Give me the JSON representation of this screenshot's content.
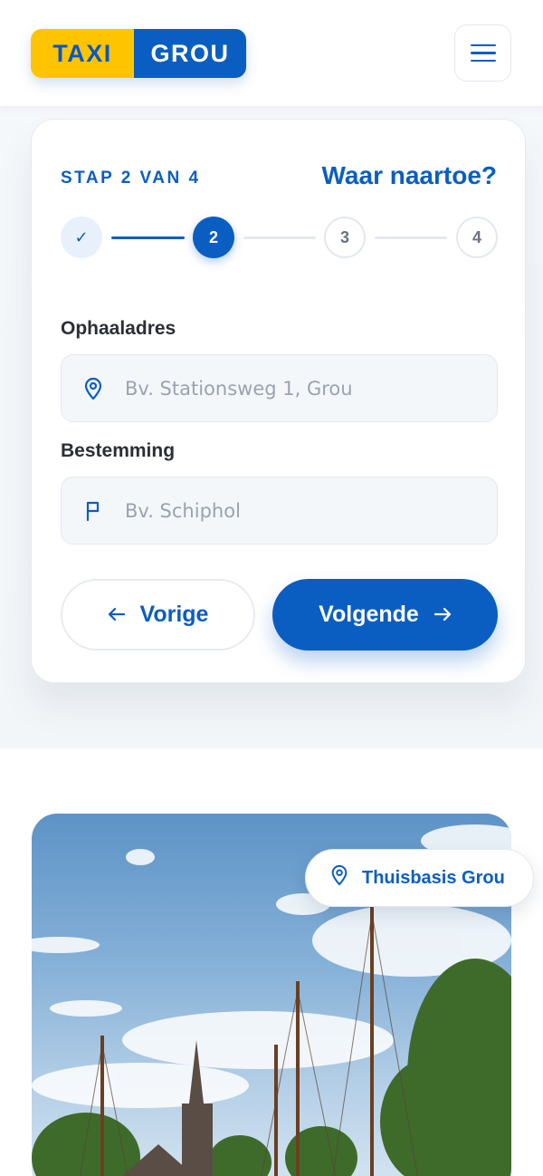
{
  "brand": {
    "part1": "TAXI",
    "part2": "GROU"
  },
  "colors": {
    "primary": "#0a5ec2",
    "accent": "#ffc400"
  },
  "booking": {
    "step_label": "STAP 2 VAN 4",
    "title": "Waar naartoe?",
    "progress": {
      "current": 2,
      "total": 4,
      "steps": [
        {
          "label": "✓",
          "state": "done"
        },
        {
          "label": "2",
          "state": "active"
        },
        {
          "label": "3",
          "state": "todo"
        },
        {
          "label": "4",
          "state": "todo"
        }
      ]
    },
    "pickup": {
      "label": "Ophaaladres",
      "placeholder": "Bv. Stationsweg 1, Grou",
      "value": "",
      "icon": "location-pin-icon"
    },
    "destination": {
      "label": "Bestemming",
      "placeholder": "Bv. Schiphol",
      "value": "",
      "icon": "flag-icon"
    },
    "prev_label": "Vorige",
    "next_label": "Volgende"
  },
  "photo": {
    "badge": "Thuisbasis Grou",
    "badge_icon": "location-pin-icon"
  }
}
